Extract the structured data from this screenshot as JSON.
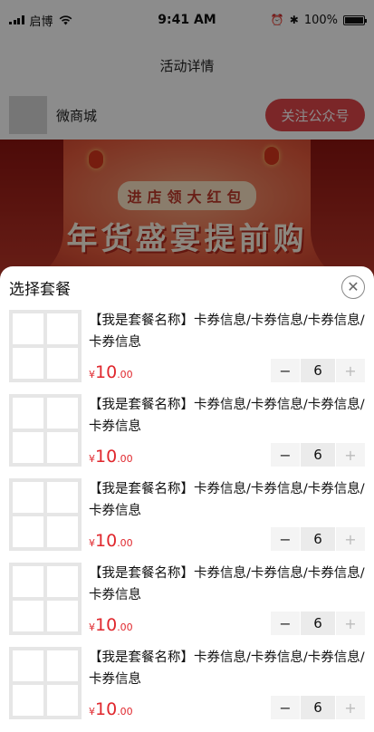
{
  "status_bar": {
    "carrier": "启博",
    "time": "9:41 AM",
    "battery": "100%"
  },
  "nav": {
    "title": "活动详情"
  },
  "shop": {
    "name": "微商城",
    "follow_label": "关注公众号"
  },
  "banner": {
    "subtitle": "进店领大红包",
    "title": "年货盛宴提前购"
  },
  "sheet": {
    "title": "选择套餐",
    "packages": [
      {
        "name": "【我是套餐名称】卡券信息/卡券信息/卡券信息/卡券信息",
        "price_symbol": "¥",
        "price_int": "10",
        "price_dec": ".00",
        "qty": "6",
        "minus": "−",
        "plus": "+"
      },
      {
        "name": "【我是套餐名称】卡券信息/卡券信息/卡券信息/卡券信息",
        "price_symbol": "¥",
        "price_int": "10",
        "price_dec": ".00",
        "qty": "6",
        "minus": "−",
        "plus": "+"
      },
      {
        "name": "【我是套餐名称】卡券信息/卡券信息/卡券信息/卡券信息",
        "price_symbol": "¥",
        "price_int": "10",
        "price_dec": ".00",
        "qty": "6",
        "minus": "−",
        "plus": "+"
      },
      {
        "name": "【我是套餐名称】卡券信息/卡券信息/卡券信息/卡券信息",
        "price_symbol": "¥",
        "price_int": "10",
        "price_dec": ".00",
        "qty": "6",
        "minus": "−",
        "plus": "+"
      },
      {
        "name": "【我是套餐名称】卡券信息/卡券信息/卡券信息/卡券信息",
        "price_symbol": "¥",
        "price_int": "10",
        "price_dec": ".00",
        "qty": "6",
        "minus": "−",
        "plus": "+"
      }
    ]
  },
  "colors": {
    "accent": "#e0454a",
    "price": "#e0282e"
  },
  "icons": {
    "close": "close-icon",
    "wifi": "wifi-icon",
    "signal": "signal-icon",
    "battery": "battery-icon",
    "bluetooth": "bluetooth-icon",
    "alarm": "alarm-icon"
  }
}
